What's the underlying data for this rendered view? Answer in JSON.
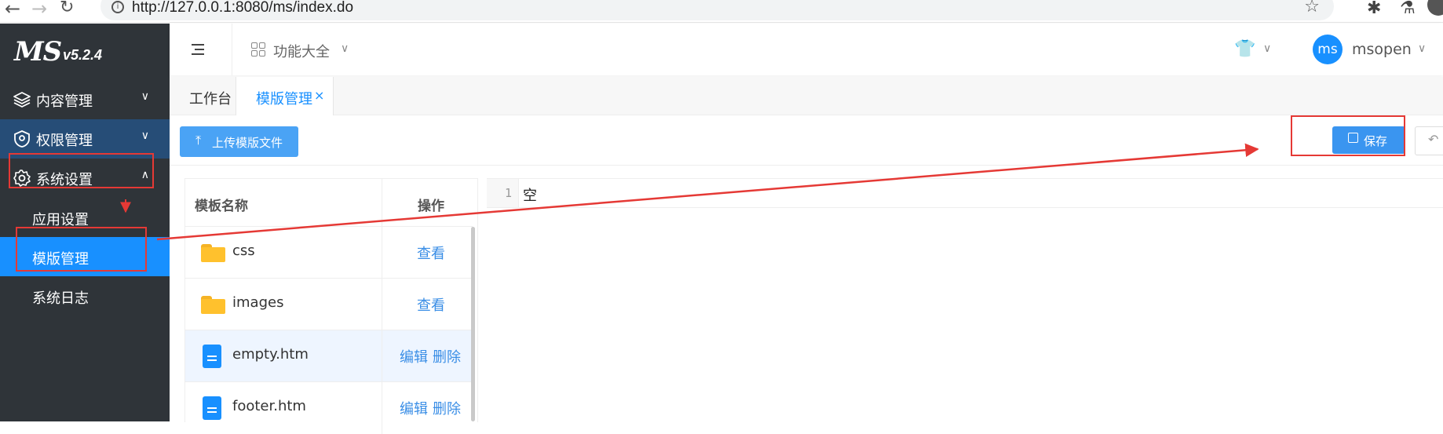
{
  "browser": {
    "url": "http://127.0.0.1:8080/ms/index.do"
  },
  "sidebar": {
    "logo": "MS",
    "version": "v5.2.4",
    "menu": [
      {
        "label": "内容管理",
        "icon": "layers-icon"
      },
      {
        "label": "权限管理",
        "icon": "shield-icon"
      },
      {
        "label": "系统设置",
        "icon": "gear-icon"
      }
    ],
    "submenu": [
      {
        "label": "应用设置"
      },
      {
        "label": "模版管理",
        "active": true
      },
      {
        "label": "系统日志"
      }
    ]
  },
  "header": {
    "func_menu_label": "功能大全",
    "user_avatar": "ms",
    "user_name": "msopen"
  },
  "tabs": [
    {
      "label": "工作台"
    },
    {
      "label": "模版管理",
      "active": true,
      "close": "×"
    }
  ],
  "toolbar": {
    "upload_label": "上传模版文件",
    "save_label": "保存"
  },
  "table": {
    "headers": {
      "name": "模板名称",
      "actions": "操作"
    },
    "rows": [
      {
        "name": "css",
        "type": "folder",
        "actions": [
          "查看"
        ]
      },
      {
        "name": "images",
        "type": "folder",
        "actions": [
          "查看"
        ]
      },
      {
        "name": "empty.htm",
        "type": "file",
        "actions": [
          "编辑",
          "删除"
        ]
      },
      {
        "name": "footer.htm",
        "type": "file",
        "actions": [
          "编辑",
          "删除"
        ]
      }
    ]
  },
  "editor": {
    "line_number": "1",
    "content": "空"
  },
  "colors": {
    "sidebar_bg": "#2f3439",
    "accent": "#1890ff",
    "annotation": "#e53935",
    "folder": "#ffc12d"
  }
}
